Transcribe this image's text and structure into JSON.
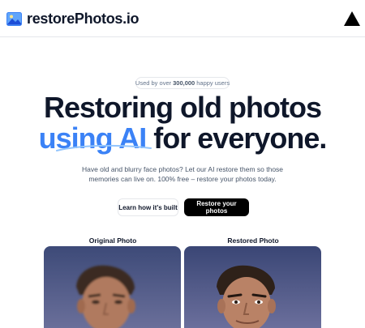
{
  "header": {
    "brand_icon": "photo-icon",
    "brand_name": "restorePhotos.io",
    "deploy_icon": "vercel-triangle-icon"
  },
  "badge": {
    "prefix": "Used by over",
    "count": "300,000",
    "suffix": "happy users"
  },
  "hero": {
    "line1": "Restoring old photos",
    "accent": "using AI",
    "rest": "for everyone.",
    "accent_color": "#3b82f6"
  },
  "subtitle": "Have old and blurry face photos? Let our AI restore them so those memories can live on. 100% free – restore your photos today.",
  "buttons": {
    "secondary_label": "Learn how it's built",
    "primary_label": "Restore your photos"
  },
  "comparison": {
    "original_label": "Original Photo",
    "restored_label": "Restored Photo"
  },
  "colors": {
    "text": "#0f172a",
    "muted": "#475569",
    "primary_button": "#000000",
    "sky": "#4a5a86"
  }
}
